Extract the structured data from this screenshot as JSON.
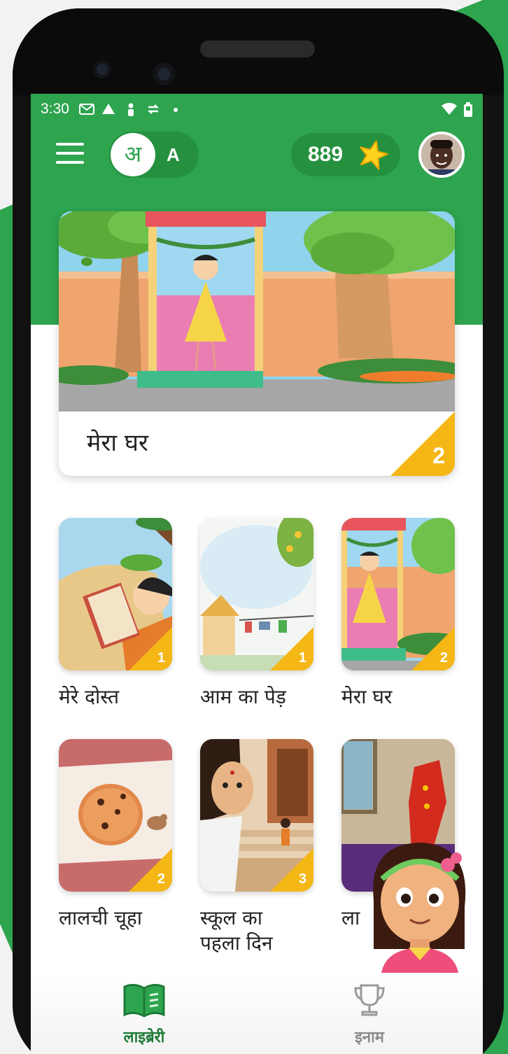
{
  "status_bar": {
    "time": "3:30"
  },
  "app_bar": {
    "language_hindi": "अ",
    "language_english": "A",
    "star_count": "889"
  },
  "featured_book": {
    "title": "मेरा घर",
    "level": "2"
  },
  "books": [
    {
      "title": "मेरे दोस्त",
      "level": "1"
    },
    {
      "title": "आम का पेड़",
      "level": "1"
    },
    {
      "title": "मेरा घर",
      "level": "2"
    },
    {
      "title": "लालची चूहा",
      "level": "2"
    },
    {
      "title_line1": "स्कूल का",
      "title_line2": "पहला दिन",
      "level": "3"
    },
    {
      "title": "ला"
    }
  ],
  "bottom_nav": {
    "library_label": "लाइब्रेरी",
    "rewards_label": "इनाम"
  },
  "colors": {
    "brand_green": "#2ea44f",
    "badge_yellow": "#f5b716"
  }
}
